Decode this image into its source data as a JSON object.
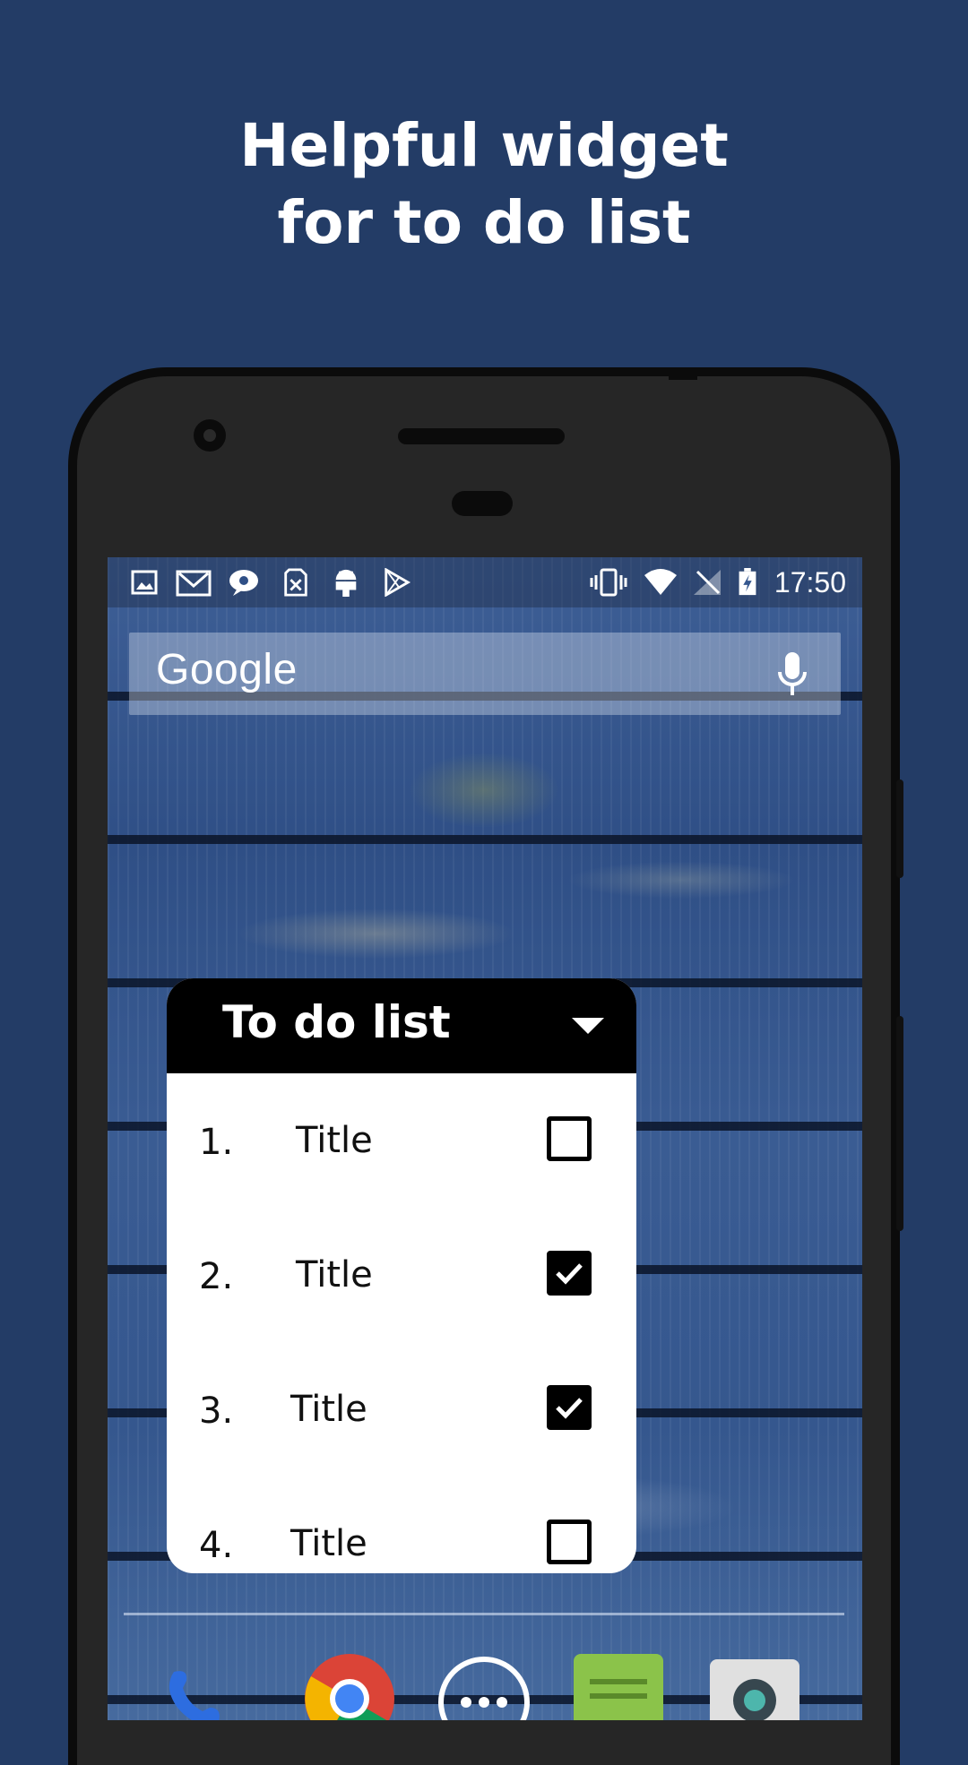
{
  "headline": {
    "line1": "Helpful widget",
    "line2": "for to do list"
  },
  "colors": {
    "background": "#233c66",
    "phone_body": "#262626",
    "widget_header": "#000000",
    "widget_body": "#ffffff"
  },
  "status_bar": {
    "left_icons": [
      "image-icon",
      "gmail-icon",
      "chat-icon",
      "sim-icon",
      "android-icon",
      "play-store-icon"
    ],
    "right_icons": [
      "vibrate-icon",
      "wifi-icon",
      "no-signal-icon",
      "battery-charging-icon"
    ],
    "time": "17:50"
  },
  "search_bar": {
    "logo_text": "Google",
    "icon": "mic-icon"
  },
  "widget": {
    "title": "To do list",
    "dropdown_icon": "caret-down-icon",
    "items": [
      {
        "number": "1.",
        "title": "Title",
        "checked": false
      },
      {
        "number": "2.",
        "title": "Title",
        "checked": true
      },
      {
        "number": "3.",
        "title": "Title",
        "checked": true
      },
      {
        "number": "4.",
        "title": "Title",
        "checked": false
      }
    ]
  },
  "dock": {
    "icons": [
      "phone-app-icon",
      "chrome-icon",
      "app-drawer-icon",
      "notes-app-icon",
      "camera-app-icon"
    ]
  }
}
